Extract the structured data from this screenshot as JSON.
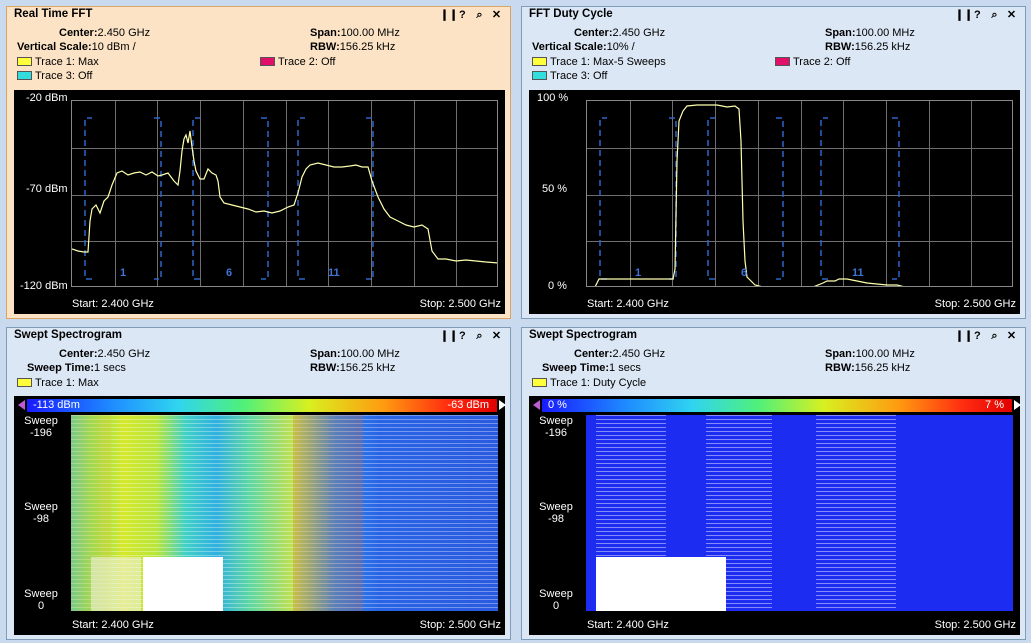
{
  "colors": {
    "trace_yellow": "#ffff3c",
    "trace_magenta": "#e0106a",
    "trace_cyan": "#33dddd",
    "channel_blue": "#2f66c9",
    "trace_line": "#ffffb0"
  },
  "window_buttons": [
    "❙❙",
    "?",
    "⌕",
    "✕"
  ],
  "icons": [
    "pause-icon",
    "help-icon",
    "zoom-icon",
    "close-icon"
  ],
  "panels": {
    "realtime": {
      "title": "Real Time FFT",
      "center_label": "Center:",
      "center_value": "2.450 GHz",
      "span_label": "Span:",
      "span_value": "100.00 MHz",
      "vscale_label": "Vertical Scale:",
      "vscale_value": "10 dBm /",
      "rbw_label": "RBW:",
      "rbw_value": "156.25 kHz",
      "trace1": "Trace 1: Max",
      "trace2": "Trace 2: Off",
      "trace3": "Trace 3: Off",
      "y_top": "-20 dBm",
      "y_mid": "-70 dBm",
      "y_bot": "-120 dBm",
      "start": "Start: 2.400 GHz",
      "stop": "Stop: 2.500 GHz",
      "channels": [
        "1",
        "6",
        "11"
      ]
    },
    "duty": {
      "title": "FFT Duty Cycle",
      "center_label": "Center:",
      "center_value": "2.450 GHz",
      "span_label": "Span:",
      "span_value": "100.00 MHz",
      "vscale_label": "Vertical Scale:",
      "vscale_value": "10% /",
      "rbw_label": "RBW:",
      "rbw_value": "156.25 kHz",
      "trace1": "Trace 1: Max-5 Sweeps",
      "trace2": "Trace 2: Off",
      "trace3": "Trace 3: Off",
      "y_top": "100 %",
      "y_mid": "50 %",
      "y_bot": "0 %",
      "start": "Start: 2.400 GHz",
      "stop": "Stop: 2.500 GHz",
      "channels": [
        "1",
        "6",
        "11"
      ]
    },
    "spectro1": {
      "title": "Swept Spectrogram",
      "center_label": "Center:",
      "center_value": "2.450 GHz",
      "span_label": "Span:",
      "span_value": "100.00 MHz",
      "sweep_label": "Sweep Time:",
      "sweep_value": "1 secs",
      "rbw_label": "RBW:",
      "rbw_value": "156.25 kHz",
      "trace1": "Trace 1: Max",
      "cb_lo": "-113 dBm",
      "cb_hi": "-63 dBm",
      "sweep_top": "Sweep\n-196",
      "sweep_mid": "Sweep\n-98",
      "sweep_bot": "Sweep\n0",
      "start": "Start: 2.400 GHz",
      "stop": "Stop: 2.500 GHz"
    },
    "spectro2": {
      "title": "Swept Spectrogram",
      "center_label": "Center:",
      "center_value": "2.450 GHz",
      "span_label": "Span:",
      "span_value": "100.00 MHz",
      "sweep_label": "Sweep Time:",
      "sweep_value": "1 secs",
      "rbw_label": "RBW:",
      "rbw_value": "156.25 kHz",
      "trace1": "Trace 1: Duty Cycle",
      "cb_lo": "0 %",
      "cb_hi": "7 %",
      "sweep_top": "Sweep\n-196",
      "sweep_mid": "Sweep\n-98",
      "sweep_bot": "Sweep\n0",
      "start": "Start: 2.400 GHz",
      "stop": "Stop: 2.500 GHz"
    }
  }
}
